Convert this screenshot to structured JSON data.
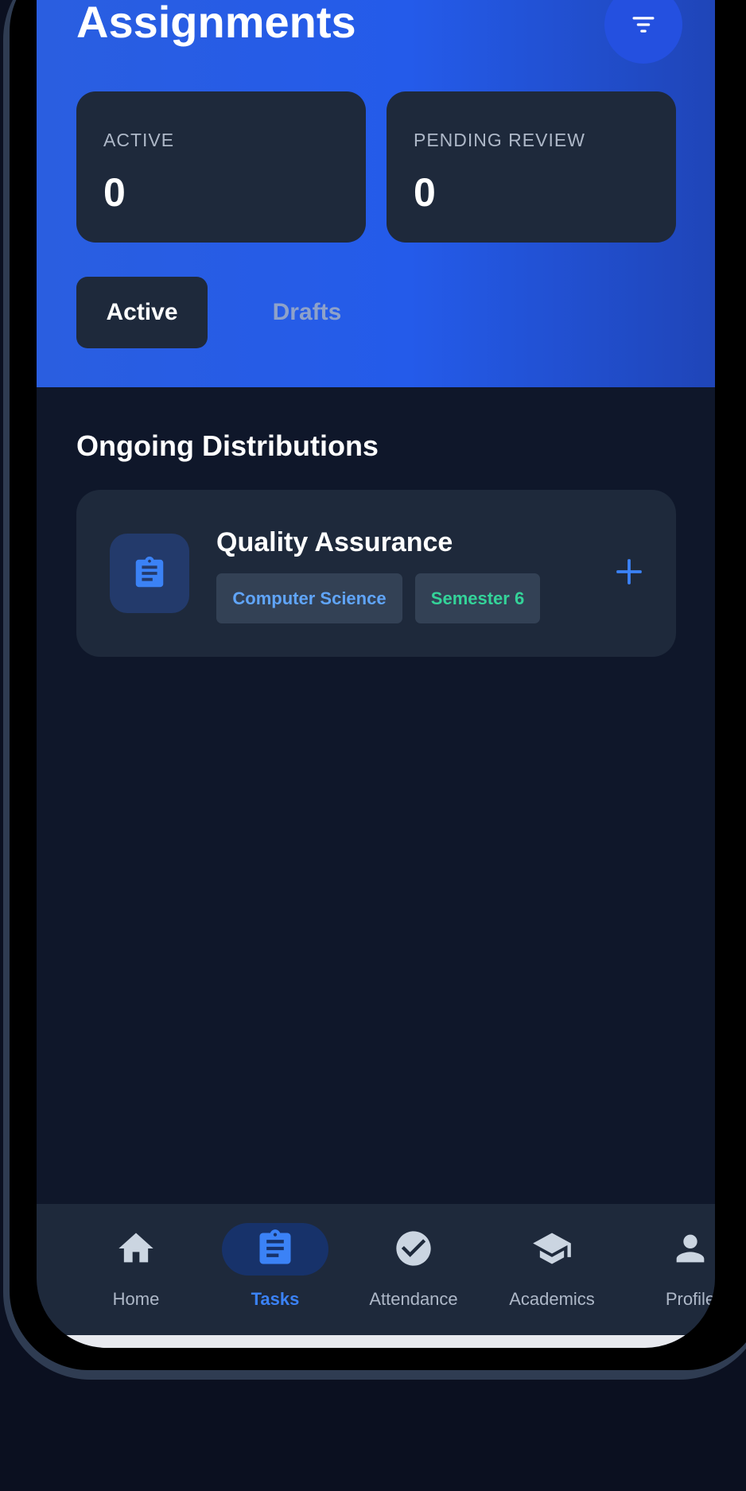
{
  "header": {
    "title": "Assignments"
  },
  "stats": [
    {
      "label": "ACTIVE",
      "value": "0"
    },
    {
      "label": "PENDING REVIEW",
      "value": "0"
    }
  ],
  "tabs": [
    {
      "label": "Active",
      "selected": true
    },
    {
      "label": "Drafts",
      "selected": false
    }
  ],
  "section": {
    "title": "Ongoing Distributions"
  },
  "distributions": [
    {
      "title": "Quality Assurance",
      "department": "Computer Science",
      "semester": "Semester 6",
      "icon": "clipboard-icon"
    }
  ],
  "nav": {
    "items": [
      {
        "label": "Home",
        "icon": "home-icon"
      },
      {
        "label": "Tasks",
        "icon": "clipboard-icon",
        "selected": true
      },
      {
        "label": "Attendance",
        "icon": "check-circle-icon"
      },
      {
        "label": "Academics",
        "icon": "graduation-cap-icon"
      },
      {
        "label": "Profile",
        "icon": "person-icon"
      }
    ]
  },
  "colors": {
    "header_gradient_start": "#2a5ee0",
    "header_gradient_end": "#1f45b8",
    "background": "#0f172a",
    "card": "#1e293b",
    "accent": "#3b82f6",
    "chip_blue_text": "#60a5fa",
    "chip_green_text": "#34d399"
  }
}
